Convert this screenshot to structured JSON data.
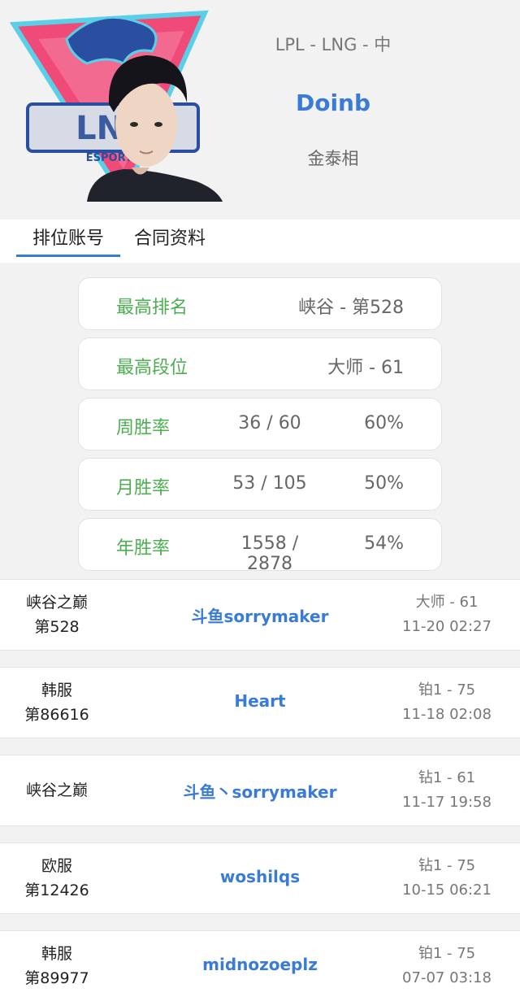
{
  "player": {
    "subline": "LPL - LNG - 中",
    "name": "Doinb",
    "real_name": "金泰相",
    "avatar_logo_text": "ESPORTS"
  },
  "tabs": [
    {
      "label": "排位账号",
      "active": true
    },
    {
      "label": "合同资料",
      "active": false
    }
  ],
  "stats": {
    "highest_rank": {
      "label": "最高排名",
      "value": "峡谷 - 第528"
    },
    "highest_tier": {
      "label": "最高段位",
      "value": "大师 - 61"
    },
    "weekly": {
      "label": "周胜率",
      "record": "36 / 60",
      "pct": "60%"
    },
    "monthly": {
      "label": "月胜率",
      "record": "53 / 105",
      "pct": "50%"
    },
    "yearly": {
      "label": "年胜率",
      "record": "1558 / 2878",
      "pct": "54%"
    }
  },
  "accounts": [
    {
      "server": "峡谷之巅",
      "rank": "第528",
      "name": "斗鱼sorrymaker",
      "tier": "大师 - 61",
      "date": "11-20 02:27"
    },
    {
      "server": "韩服",
      "rank": "第86616",
      "name": "Heart",
      "tier": "铂1 - 75",
      "date": "11-18 02:08"
    },
    {
      "server": "峡谷之巅",
      "rank": "",
      "name": "斗鱼丶sorrymaker",
      "tier": "钻1 - 61",
      "date": "11-17 19:58"
    },
    {
      "server": "欧服",
      "rank": "第12426",
      "name": "woshilqs",
      "tier": "钻1 - 75",
      "date": "10-15 06:21"
    },
    {
      "server": "韩服",
      "rank": "第89977",
      "name": "midnozoeplz",
      "tier": "铂1 - 75",
      "date": "07-07 03:18"
    }
  ],
  "colors": {
    "accent_blue": "#3a7bd5",
    "stat_label_green": "#4caf50",
    "logo_red": "#e8426b",
    "logo_blue": "#2a4fa0"
  }
}
